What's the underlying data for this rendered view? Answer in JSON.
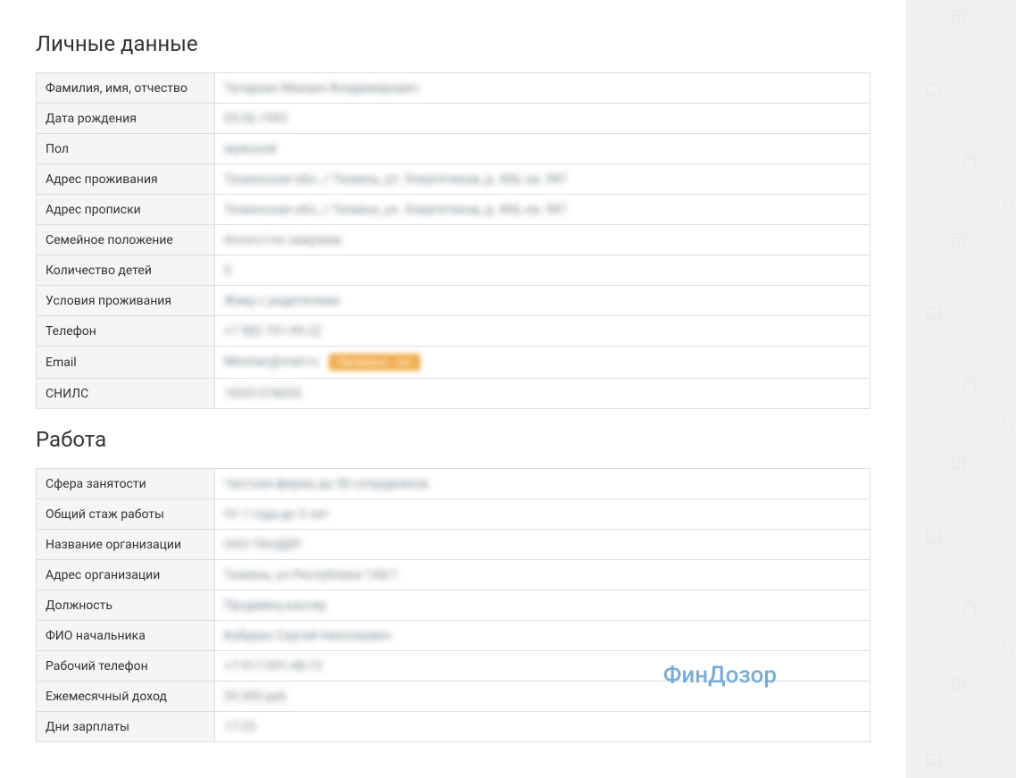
{
  "watermark": "ФинДозор",
  "sections": {
    "personal": {
      "title": "Личные данные",
      "rows": [
        {
          "label": "Фамилия, имя, отчество",
          "value": "Татаркин Михаил Владимирович"
        },
        {
          "label": "Дата рождения",
          "value": "05.06.1993"
        },
        {
          "label": "Пол",
          "value": "мужской"
        },
        {
          "label": "Адрес проживания",
          "value": "Тюменская обл., г Тюмень, ул. Энергетиков, д. 466, кв. 987"
        },
        {
          "label": "Адрес прописки",
          "value": "Тюменская обл., г Тюмень, ул. Энергетиков, д. 466, кв. 987"
        },
        {
          "label": "Семейное положение",
          "value": "Холост/не замужем"
        },
        {
          "label": "Количество детей",
          "value": "0"
        },
        {
          "label": "Условия проживания",
          "value": "Живу с родителями"
        },
        {
          "label": "Телефон",
          "value": "+7 982 701-99-22"
        },
        {
          "label": "Email",
          "value": "Mixotan@mail.ru",
          "badge": "Проверено · нет"
        },
        {
          "label": "СНИЛС",
          "value": "18331378053"
        }
      ]
    },
    "work": {
      "title": "Работа",
      "rows": [
        {
          "label": "Сфера занятости",
          "value": "Частная фирма до 50 сотрудников"
        },
        {
          "label": "Общий стаж работы",
          "value": "От 1 года до 3 лет"
        },
        {
          "label": "Название организации",
          "value": "ООО ТАНДЕР"
        },
        {
          "label": "Адрес организации",
          "value": "Тюмень, ул Республики 148/1"
        },
        {
          "label": "Должность",
          "value": "Продавец-кассир"
        },
        {
          "label": "ФИО начальника",
          "value": "Бабурин Сергей Николаевич"
        },
        {
          "label": "Рабочий телефон",
          "value": "+7-917-091-48-72"
        },
        {
          "label": "Ежемесячный доход",
          "value": "35 000 руб."
        },
        {
          "label": "Дни зарплаты",
          "value": "17-25"
        }
      ]
    }
  }
}
